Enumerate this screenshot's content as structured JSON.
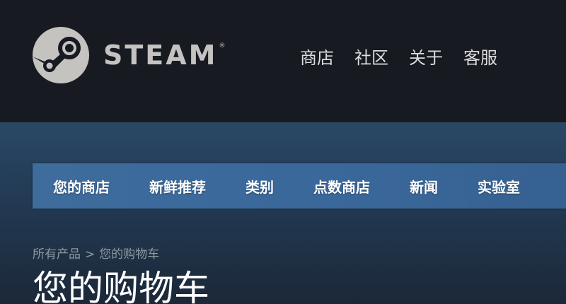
{
  "header": {
    "logo_text": "STEAM",
    "logo_registered": "®",
    "logo_icon": "steam-logo-icon",
    "nav": [
      {
        "label": "商店"
      },
      {
        "label": "社区"
      },
      {
        "label": "关于"
      },
      {
        "label": "客服"
      }
    ]
  },
  "store_nav": {
    "tabs": [
      {
        "label": "您的商店"
      },
      {
        "label": "新鲜推荐"
      },
      {
        "label": "类别"
      },
      {
        "label": "点数商店"
      },
      {
        "label": "新闻"
      },
      {
        "label": "实验室"
      }
    ]
  },
  "breadcrumb": {
    "root": "所有产品",
    "separator": ">",
    "current": "您的购物车"
  },
  "page_title": "您的购物车",
  "colors": {
    "header_bg": "#171a21",
    "page_bg": "#1b2838",
    "store_nav_bg": "#3e6c9d",
    "logo": "#c5c3c0"
  }
}
